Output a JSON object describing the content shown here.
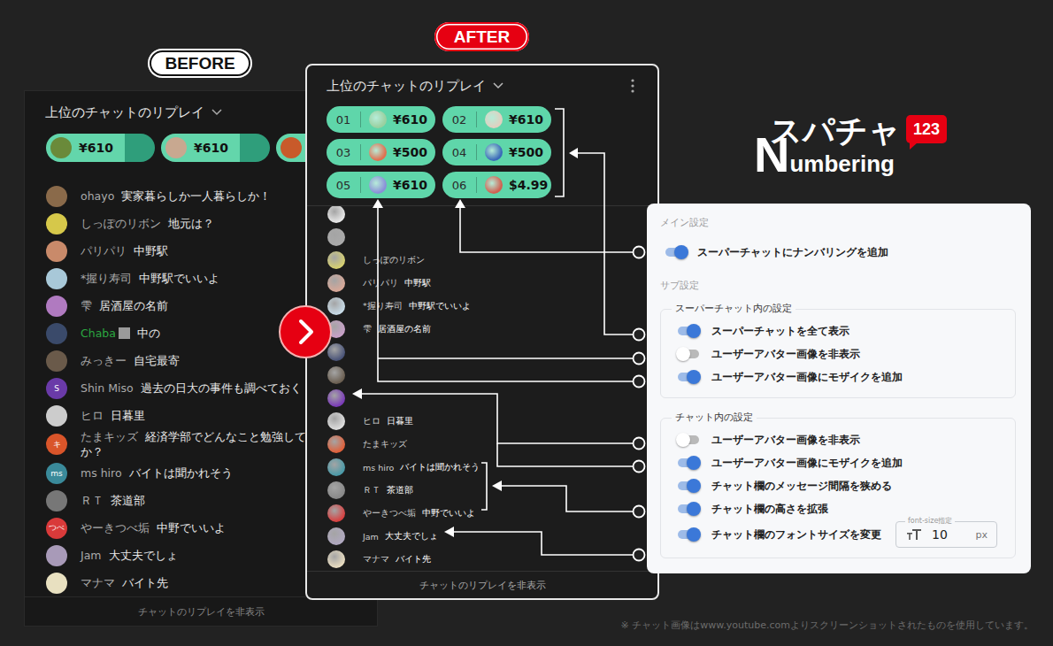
{
  "badges": {
    "before": "BEFORE",
    "after": "AFTER"
  },
  "before_panel": {
    "title": "上位のチャットのリプレイ",
    "tickers": [
      {
        "amount": "¥610",
        "color": "#6a8a3a"
      },
      {
        "amount": "¥610",
        "color": "#c8a890"
      },
      {
        "amount": "",
        "color": "#c85a2a"
      }
    ],
    "messages": [
      {
        "author": "ohayo",
        "message": "実家暮らしか一人暮らしか！",
        "color": "#8a6a4a",
        "member": false
      },
      {
        "author": "しっぽのリボン",
        "message": "地元は？",
        "color": "#d6c84a",
        "member": false
      },
      {
        "author": "パリパリ",
        "message": "中野駅",
        "color": "#c98a6a",
        "member": false
      },
      {
        "author": "*握り寿司",
        "message": "中野駅でいいよ",
        "color": "#a8c8d8",
        "member": false
      },
      {
        "author": "雫",
        "message": "居酒屋の名前",
        "color": "#b07ac0",
        "member": false
      },
      {
        "author": "Chaba",
        "message": "中の",
        "color": "#3a4a6a",
        "member": true
      },
      {
        "author": "みっきー",
        "message": "自宅最寄",
        "color": "#6a5a4a",
        "member": false
      },
      {
        "author": "Shin Miso",
        "message": "過去の日大の事件も調べておく",
        "color": "#6a3aa8",
        "avatar_text": "S",
        "member": false
      },
      {
        "author": "ヒロ",
        "message": "日暮里",
        "color": "#cccccc",
        "member": false
      },
      {
        "author": "たまキッズ",
        "message": "経済学部でどんなこと勉強して",
        "more": "か？",
        "color": "#d9552a",
        "avatar_text": "キ",
        "member": false
      },
      {
        "author": "ms hiro",
        "message": "バイトは聞かれそう",
        "color": "#3a8a9a",
        "avatar_text": "ms",
        "member": false
      },
      {
        "author": "ＲＴ",
        "message": "茶道部",
        "color": "#777777",
        "member": false
      },
      {
        "author": "やーきつべ垢",
        "message": "中野でいいよ",
        "color": "#d93a3a",
        "avatar_text": "つべ",
        "member": false
      },
      {
        "author": "Jam",
        "message": "大丈夫でしょ",
        "color": "#a89ab8",
        "member": false
      },
      {
        "author": "マナマ",
        "message": "バイト先",
        "color": "#e8e0c0",
        "member": false
      }
    ],
    "footer": "チャットのリプレイを非表示"
  },
  "after_panel": {
    "title": "上位のチャットのリプレイ",
    "tickers": [
      {
        "rank": "01",
        "amount": "¥610",
        "color": "#9ad0a0"
      },
      {
        "rank": "02",
        "amount": "¥610",
        "color": "#e0d0c0"
      },
      {
        "rank": "03",
        "amount": "¥500",
        "color": "#e07050"
      },
      {
        "rank": "04",
        "amount": "¥500",
        "color": "#3a6ab8"
      },
      {
        "rank": "05",
        "amount": "¥610",
        "color": "#8a90d8"
      },
      {
        "rank": "06",
        "amount": "$4.99",
        "color": "#d06050"
      }
    ],
    "messages": [
      {
        "author": "",
        "message": "",
        "color": "#e8e8e8"
      },
      {
        "author": "",
        "message": "",
        "color": "#aaaaaa"
      },
      {
        "author": "しっぽのリボン",
        "message": "",
        "color": "#d6d070"
      },
      {
        "author": "パリパリ",
        "message": "中野駅",
        "color": "#d8a898"
      },
      {
        "author": "*握り寿司",
        "message": "中野駅でいいよ",
        "color": "#c8dce8"
      },
      {
        "author": "雫",
        "message": "居酒屋の名前",
        "color": "#c8a0c8"
      },
      {
        "author": "",
        "message": "",
        "color": "#4a5478"
      },
      {
        "author": "",
        "message": "",
        "color": "#6a5e50"
      },
      {
        "author": "",
        "message": "",
        "color": "#7a3ab8"
      },
      {
        "author": "ヒロ",
        "message": "日暮里",
        "color": "#dddddd"
      },
      {
        "author": "たまキッズ",
        "message": "",
        "color": "#e0603a"
      },
      {
        "author": "ms hiro",
        "message": "バイトは聞かれそう",
        "color": "#4a9aa8"
      },
      {
        "author": "ＲＴ",
        "message": "茶道部",
        "color": "#888888"
      },
      {
        "author": "やーきつべ垢",
        "message": "中野でいいよ",
        "color": "#d84040"
      },
      {
        "author": "Jam",
        "message": "大丈夫でしょ",
        "color": "#b0a8c0"
      },
      {
        "author": "マナマ",
        "message": "バイト先",
        "color": "#e8dcc0"
      }
    ],
    "footer": "チャットのリプレイを非表示"
  },
  "logo": {
    "title": "スパチャ",
    "initial": "N",
    "rest": "umbering",
    "badge": "123"
  },
  "settings": {
    "main_heading": "メイン設定",
    "main_toggles": [
      {
        "label": "スーパーチャットにナンバリングを追加",
        "on": true
      }
    ],
    "sub_heading": "サブ設定",
    "groups": [
      {
        "title": "スーパーチャット内の設定",
        "toggles": [
          {
            "label": "スーパーチャットを全て表示",
            "on": true
          },
          {
            "label": "ユーザーアバター画像を非表示",
            "on": false
          },
          {
            "label": "ユーザーアバター画像にモザイクを追加",
            "on": true
          }
        ]
      },
      {
        "title": "チャット内の設定",
        "toggles": [
          {
            "label": "ユーザーアバター画像を非表示",
            "on": false
          },
          {
            "label": "ユーザーアバター画像にモザイクを追加",
            "on": true
          },
          {
            "label": "チャット欄のメッセージ間隔を狭める",
            "on": true
          },
          {
            "label": "チャット欄の高さを拡張",
            "on": true
          },
          {
            "label": "チャット欄のフォントサイズを変更",
            "on": true,
            "field": {
              "legend": "font-size指定",
              "value": "10",
              "unit": "px"
            }
          }
        ]
      }
    ]
  },
  "footnote": "※ チャット画像はwww.youtube.comよりスクリーンショットされたものを使用しています。"
}
